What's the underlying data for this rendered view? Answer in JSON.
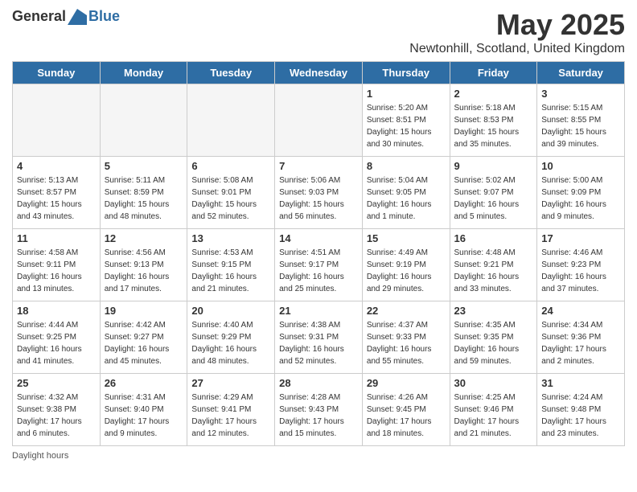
{
  "header": {
    "logo_general": "General",
    "logo_blue": "Blue",
    "month_title": "May 2025",
    "location": "Newtonhill, Scotland, United Kingdom"
  },
  "weekdays": [
    "Sunday",
    "Monday",
    "Tuesday",
    "Wednesday",
    "Thursday",
    "Friday",
    "Saturday"
  ],
  "footer": {
    "daylight_hours": "Daylight hours"
  },
  "weeks": [
    [
      {
        "day": "",
        "sunrise": "",
        "sunset": "",
        "daylight": "",
        "empty": true
      },
      {
        "day": "",
        "sunrise": "",
        "sunset": "",
        "daylight": "",
        "empty": true
      },
      {
        "day": "",
        "sunrise": "",
        "sunset": "",
        "daylight": "",
        "empty": true
      },
      {
        "day": "",
        "sunrise": "",
        "sunset": "",
        "daylight": "",
        "empty": true
      },
      {
        "day": "1",
        "sunrise": "Sunrise: 5:20 AM",
        "sunset": "Sunset: 8:51 PM",
        "daylight": "Daylight: 15 hours and 30 minutes.",
        "empty": false
      },
      {
        "day": "2",
        "sunrise": "Sunrise: 5:18 AM",
        "sunset": "Sunset: 8:53 PM",
        "daylight": "Daylight: 15 hours and 35 minutes.",
        "empty": false
      },
      {
        "day": "3",
        "sunrise": "Sunrise: 5:15 AM",
        "sunset": "Sunset: 8:55 PM",
        "daylight": "Daylight: 15 hours and 39 minutes.",
        "empty": false
      }
    ],
    [
      {
        "day": "4",
        "sunrise": "Sunrise: 5:13 AM",
        "sunset": "Sunset: 8:57 PM",
        "daylight": "Daylight: 15 hours and 43 minutes.",
        "empty": false
      },
      {
        "day": "5",
        "sunrise": "Sunrise: 5:11 AM",
        "sunset": "Sunset: 8:59 PM",
        "daylight": "Daylight: 15 hours and 48 minutes.",
        "empty": false
      },
      {
        "day": "6",
        "sunrise": "Sunrise: 5:08 AM",
        "sunset": "Sunset: 9:01 PM",
        "daylight": "Daylight: 15 hours and 52 minutes.",
        "empty": false
      },
      {
        "day": "7",
        "sunrise": "Sunrise: 5:06 AM",
        "sunset": "Sunset: 9:03 PM",
        "daylight": "Daylight: 15 hours and 56 minutes.",
        "empty": false
      },
      {
        "day": "8",
        "sunrise": "Sunrise: 5:04 AM",
        "sunset": "Sunset: 9:05 PM",
        "daylight": "Daylight: 16 hours and 1 minute.",
        "empty": false
      },
      {
        "day": "9",
        "sunrise": "Sunrise: 5:02 AM",
        "sunset": "Sunset: 9:07 PM",
        "daylight": "Daylight: 16 hours and 5 minutes.",
        "empty": false
      },
      {
        "day": "10",
        "sunrise": "Sunrise: 5:00 AM",
        "sunset": "Sunset: 9:09 PM",
        "daylight": "Daylight: 16 hours and 9 minutes.",
        "empty": false
      }
    ],
    [
      {
        "day": "11",
        "sunrise": "Sunrise: 4:58 AM",
        "sunset": "Sunset: 9:11 PM",
        "daylight": "Daylight: 16 hours and 13 minutes.",
        "empty": false
      },
      {
        "day": "12",
        "sunrise": "Sunrise: 4:56 AM",
        "sunset": "Sunset: 9:13 PM",
        "daylight": "Daylight: 16 hours and 17 minutes.",
        "empty": false
      },
      {
        "day": "13",
        "sunrise": "Sunrise: 4:53 AM",
        "sunset": "Sunset: 9:15 PM",
        "daylight": "Daylight: 16 hours and 21 minutes.",
        "empty": false
      },
      {
        "day": "14",
        "sunrise": "Sunrise: 4:51 AM",
        "sunset": "Sunset: 9:17 PM",
        "daylight": "Daylight: 16 hours and 25 minutes.",
        "empty": false
      },
      {
        "day": "15",
        "sunrise": "Sunrise: 4:49 AM",
        "sunset": "Sunset: 9:19 PM",
        "daylight": "Daylight: 16 hours and 29 minutes.",
        "empty": false
      },
      {
        "day": "16",
        "sunrise": "Sunrise: 4:48 AM",
        "sunset": "Sunset: 9:21 PM",
        "daylight": "Daylight: 16 hours and 33 minutes.",
        "empty": false
      },
      {
        "day": "17",
        "sunrise": "Sunrise: 4:46 AM",
        "sunset": "Sunset: 9:23 PM",
        "daylight": "Daylight: 16 hours and 37 minutes.",
        "empty": false
      }
    ],
    [
      {
        "day": "18",
        "sunrise": "Sunrise: 4:44 AM",
        "sunset": "Sunset: 9:25 PM",
        "daylight": "Daylight: 16 hours and 41 minutes.",
        "empty": false
      },
      {
        "day": "19",
        "sunrise": "Sunrise: 4:42 AM",
        "sunset": "Sunset: 9:27 PM",
        "daylight": "Daylight: 16 hours and 45 minutes.",
        "empty": false
      },
      {
        "day": "20",
        "sunrise": "Sunrise: 4:40 AM",
        "sunset": "Sunset: 9:29 PM",
        "daylight": "Daylight: 16 hours and 48 minutes.",
        "empty": false
      },
      {
        "day": "21",
        "sunrise": "Sunrise: 4:38 AM",
        "sunset": "Sunset: 9:31 PM",
        "daylight": "Daylight: 16 hours and 52 minutes.",
        "empty": false
      },
      {
        "day": "22",
        "sunrise": "Sunrise: 4:37 AM",
        "sunset": "Sunset: 9:33 PM",
        "daylight": "Daylight: 16 hours and 55 minutes.",
        "empty": false
      },
      {
        "day": "23",
        "sunrise": "Sunrise: 4:35 AM",
        "sunset": "Sunset: 9:35 PM",
        "daylight": "Daylight: 16 hours and 59 minutes.",
        "empty": false
      },
      {
        "day": "24",
        "sunrise": "Sunrise: 4:34 AM",
        "sunset": "Sunset: 9:36 PM",
        "daylight": "Daylight: 17 hours and 2 minutes.",
        "empty": false
      }
    ],
    [
      {
        "day": "25",
        "sunrise": "Sunrise: 4:32 AM",
        "sunset": "Sunset: 9:38 PM",
        "daylight": "Daylight: 17 hours and 6 minutes.",
        "empty": false
      },
      {
        "day": "26",
        "sunrise": "Sunrise: 4:31 AM",
        "sunset": "Sunset: 9:40 PM",
        "daylight": "Daylight: 17 hours and 9 minutes.",
        "empty": false
      },
      {
        "day": "27",
        "sunrise": "Sunrise: 4:29 AM",
        "sunset": "Sunset: 9:41 PM",
        "daylight": "Daylight: 17 hours and 12 minutes.",
        "empty": false
      },
      {
        "day": "28",
        "sunrise": "Sunrise: 4:28 AM",
        "sunset": "Sunset: 9:43 PM",
        "daylight": "Daylight: 17 hours and 15 minutes.",
        "empty": false
      },
      {
        "day": "29",
        "sunrise": "Sunrise: 4:26 AM",
        "sunset": "Sunset: 9:45 PM",
        "daylight": "Daylight: 17 hours and 18 minutes.",
        "empty": false
      },
      {
        "day": "30",
        "sunrise": "Sunrise: 4:25 AM",
        "sunset": "Sunset: 9:46 PM",
        "daylight": "Daylight: 17 hours and 21 minutes.",
        "empty": false
      },
      {
        "day": "31",
        "sunrise": "Sunrise: 4:24 AM",
        "sunset": "Sunset: 9:48 PM",
        "daylight": "Daylight: 17 hours and 23 minutes.",
        "empty": false
      }
    ]
  ]
}
